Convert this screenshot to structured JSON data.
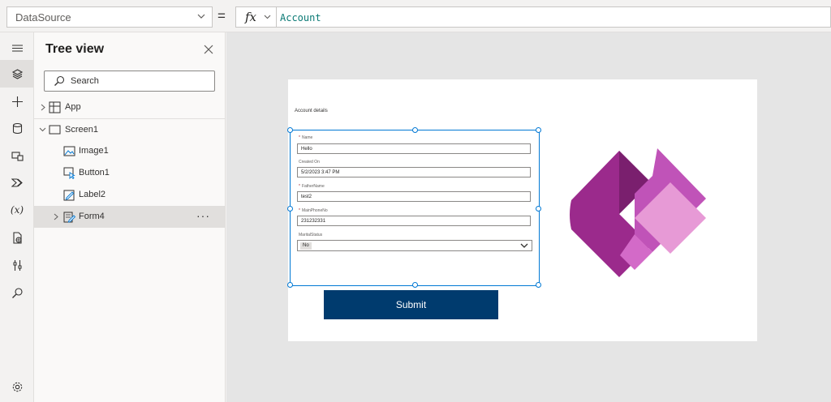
{
  "formula_bar": {
    "property": "DataSource",
    "equals": "=",
    "fx": "fx",
    "formula": "Account"
  },
  "rail": {
    "items": [
      "menu-icon",
      "layers-icon",
      "add-icon",
      "data-icon",
      "media-icon",
      "power-automate-icon",
      "variables-icon",
      "advanced-tools-icon",
      "settings-tools-icon",
      "search-icon",
      "settings-icon"
    ],
    "variables_text": "(x)"
  },
  "tree": {
    "title": "Tree view",
    "search_placeholder": "Search",
    "items": [
      {
        "label": "App"
      },
      {
        "label": "Screen1"
      },
      {
        "label": "Image1"
      },
      {
        "label": "Button1"
      },
      {
        "label": "Label2"
      },
      {
        "label": "Form4"
      }
    ],
    "more": "···"
  },
  "canvas": {
    "screen_title": "Account details",
    "form": {
      "fields": [
        {
          "label": "Name",
          "required": true,
          "value": "Hello"
        },
        {
          "label": "Created On",
          "required": false,
          "value": "5/2/2023 3:47 PM"
        },
        {
          "label": "FatherName",
          "required": true,
          "value": "test2"
        },
        {
          "label": "MainPhoneNo",
          "required": true,
          "value": "231232331"
        },
        {
          "label": "MaritalStatus",
          "required": false,
          "value": "No"
        }
      ],
      "required_marker": "*"
    },
    "submit_label": "Submit"
  },
  "colors": {
    "accent": "#0078d4",
    "submit": "#003b6e",
    "formula_text": "#0b7a75",
    "logo_dark": "#7a1f6e",
    "logo_mid": "#c053b8",
    "logo_light": "#e79ad6"
  }
}
